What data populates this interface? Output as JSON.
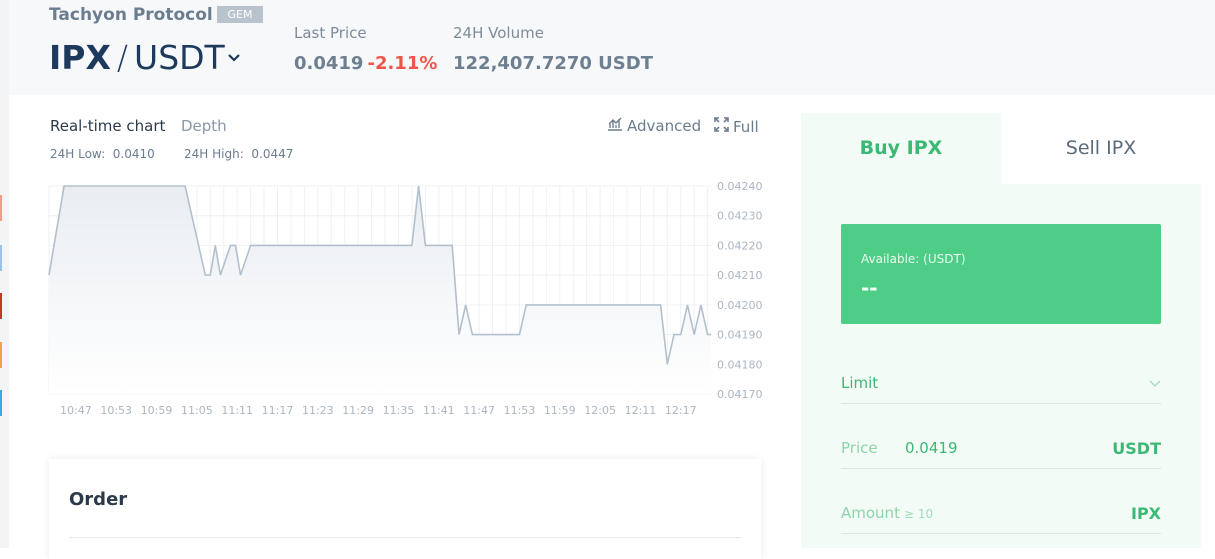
{
  "header": {
    "project_name": "Tachyon Protocol",
    "badge": "GEM",
    "pair_base": "IPX",
    "pair_separator": "/",
    "pair_quote": "USDT",
    "last_price_label": "Last Price",
    "last_price": "0.0419",
    "change": "-2.11%",
    "volume_label": "24H Volume",
    "volume": "122,407.7270 USDT"
  },
  "chart_panel": {
    "tab_realtime": "Real-time chart",
    "tab_depth": "Depth",
    "advanced_label": "Advanced",
    "full_label": "Full",
    "low_label": "24H Low:",
    "low_value": "0.0410",
    "high_label": "24H High:",
    "high_value": "0.0447"
  },
  "chart_data": {
    "type": "area",
    "x_ticks": [
      "10:47",
      "10:53",
      "10:59",
      "11:05",
      "11:11",
      "11:17",
      "11:23",
      "11:29",
      "11:35",
      "11:41",
      "11:47",
      "11:53",
      "11:59",
      "12:05",
      "12:11",
      "12:17"
    ],
    "y_ticks": [
      "0.04240",
      "0.04230",
      "0.04220",
      "0.04210",
      "0.04200",
      "0.04190",
      "0.04180",
      "0.04170"
    ],
    "ylim": [
      0.0417,
      0.0424
    ],
    "xlim_minutes": [
      0,
      98.5
    ],
    "grid": true,
    "colors": {
      "line": "#b3c0cc",
      "fill_top": "#e9edf2",
      "grid": "#eef1f4"
    },
    "points": [
      [
        0,
        0.0421
      ],
      [
        0.75,
        0.0422
      ],
      [
        2.25,
        0.0424
      ],
      [
        20.25,
        0.0424
      ],
      [
        23.25,
        0.0421
      ],
      [
        24,
        0.0421
      ],
      [
        24.75,
        0.0422
      ],
      [
        25.5,
        0.0421
      ],
      [
        27,
        0.0422
      ],
      [
        27.75,
        0.0422
      ],
      [
        28.5,
        0.0421
      ],
      [
        30,
        0.0422
      ],
      [
        54,
        0.0422
      ],
      [
        55,
        0.0424
      ],
      [
        56,
        0.0422
      ],
      [
        60,
        0.0422
      ],
      [
        61,
        0.0419
      ],
      [
        62,
        0.042
      ],
      [
        63,
        0.0419
      ],
      [
        70,
        0.0419
      ],
      [
        71,
        0.042
      ],
      [
        91,
        0.042
      ],
      [
        92,
        0.0418
      ],
      [
        93,
        0.0419
      ],
      [
        94,
        0.0419
      ],
      [
        95,
        0.042
      ],
      [
        96,
        0.0419
      ],
      [
        97,
        0.042
      ],
      [
        98,
        0.0419
      ],
      [
        98.5,
        0.0419
      ]
    ]
  },
  "order": {
    "title": "Order"
  },
  "trade": {
    "buy_tab": "Buy IPX",
    "sell_tab": "Sell IPX",
    "available_label": "Available: (USDT)",
    "available_value": "--",
    "order_type": "Limit",
    "price_label": "Price",
    "price_value": "0.0419",
    "price_unit": "USDT",
    "amount_label": "Amount",
    "amount_hint": "≥ 10",
    "amount_unit": "IPX"
  }
}
